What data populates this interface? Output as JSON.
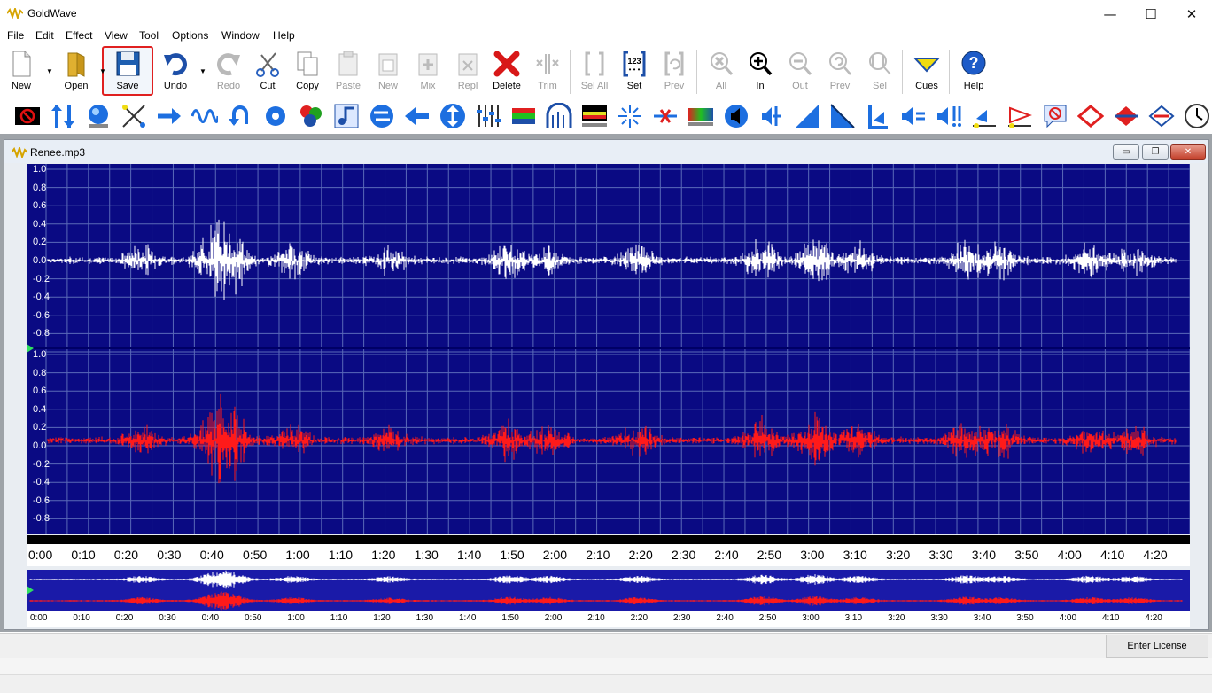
{
  "window": {
    "title": "GoldWave",
    "minimize": "—",
    "maximize": "☐",
    "close": "✕"
  },
  "menu": [
    "File",
    "Edit",
    "Effect",
    "View",
    "Tool",
    "Options",
    "Window",
    "Help"
  ],
  "toolbar": {
    "new": "New",
    "open": "Open",
    "save": "Save",
    "undo": "Undo",
    "redo": "Redo",
    "cut": "Cut",
    "copy": "Copy",
    "paste": "Paste",
    "paste_new": "New",
    "mix": "Mix",
    "replace": "Repl",
    "delete": "Delete",
    "trim": "Trim",
    "sel_all": "Sel All",
    "set": "Set",
    "prev": "Prev",
    "zoom_all": "All",
    "zoom_in": "In",
    "zoom_out": "Out",
    "zoom_prev": "Prev",
    "zoom_sel": "Sel",
    "cues": "Cues",
    "help": "Help"
  },
  "document": {
    "filename": "Renee.mp3",
    "y_labels": [
      "1.0",
      "0.8",
      "0.6",
      "0.4",
      "0.2",
      "0.0",
      "-0.2",
      "-0.4",
      "-0.6",
      "-0.8"
    ],
    "time_labels": [
      "0:00",
      "0:10",
      "0:20",
      "0:30",
      "0:40",
      "0:50",
      "1:00",
      "1:10",
      "1:20",
      "1:30",
      "1:40",
      "1:50",
      "2:00",
      "2:10",
      "2:20",
      "2:30",
      "2:40",
      "2:50",
      "3:00",
      "3:10",
      "3:20",
      "3:30",
      "3:40",
      "3:50",
      "4:00",
      "4:10",
      "4:20"
    ],
    "colors": {
      "background": "#0a0a83",
      "left_channel": "#ffffff",
      "right_channel": "#ff1a1a",
      "grid": "#5a6ab8"
    }
  },
  "status": {
    "license_button": "Enter License"
  }
}
